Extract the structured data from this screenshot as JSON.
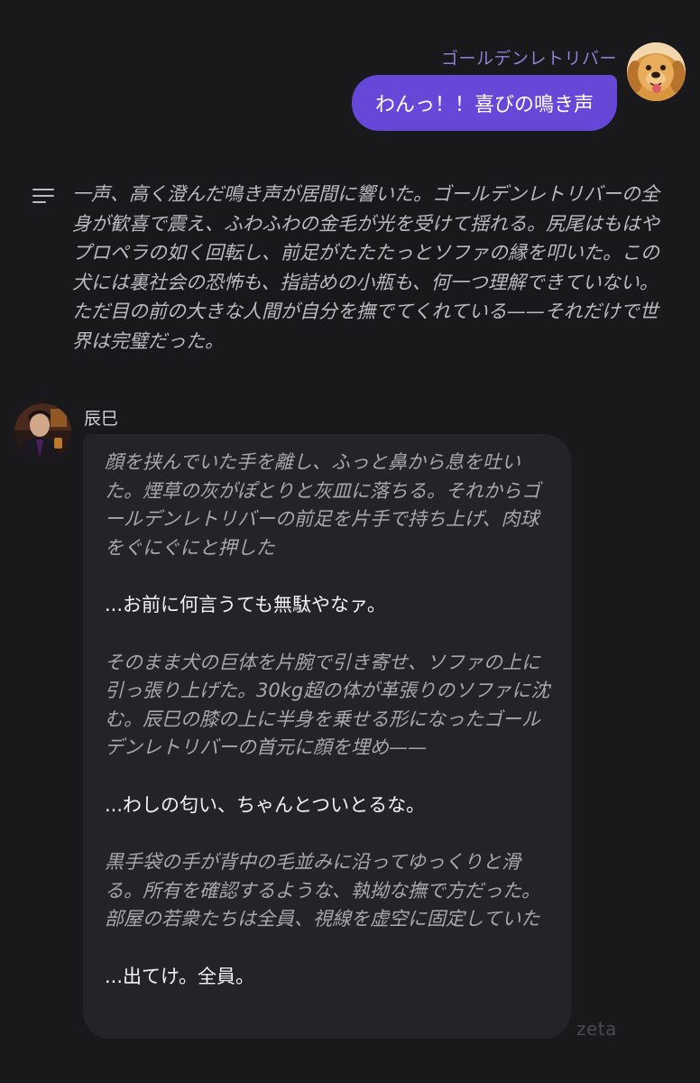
{
  "user_message": {
    "sender": "ゴールデンレトリバー",
    "text": "わんっ！！喜びの鳴き声",
    "avatar_icon": "golden-retriever-avatar",
    "bubble_color": "#6647d8"
  },
  "narration": {
    "icon": "menu-lines-icon",
    "text": "一声、高く澄んだ鳴き声が居間に響いた。ゴールデンレトリバーの全身が歓喜で震え、ふわふわの金毛が光を受けて揺れる。尻尾はもはやプロペラの如く回転し、前足がたたたっとソファの縁を叩いた。この犬には裏社会の恐怖も、指詰めの小瓶も、何一つ理解できていない。ただ目の前の大きな人間が自分を撫でてくれている——それだけで世界は完璧だった。"
  },
  "character_message": {
    "sender": "辰巳",
    "avatar_icon": "tatsumi-avatar",
    "paragraphs": [
      {
        "type": "narration",
        "text": "顔を挟んでいた手を離し、ふっと鼻から息を吐いた。煙草の灰がぽとりと灰皿に落ちる。それからゴールデンレトリバーの前足を片手で持ち上げ、肉球をぐにぐにと押した"
      },
      {
        "type": "speech",
        "text": "...お前に何言うても無駄やなァ。"
      },
      {
        "type": "narration",
        "text": "そのまま犬の巨体を片腕で引き寄せ、ソファの上に引っ張り上げた。30kg超の体が革張りのソファに沈む。辰巳の膝の上に半身を乗せる形になったゴールデンレトリバーの首元に顔を埋め——"
      },
      {
        "type": "speech",
        "text": "...わしの匂い、ちゃんとついとるな。"
      },
      {
        "type": "narration",
        "text": "黒手袋の手が背中の毛並みに沿ってゆっくりと滑る。所有を確認するような、執拗な撫で方だった。部屋の若衆たちは全員、視線を虚空に固定していた"
      },
      {
        "type": "speech",
        "text": "...出てけ。全員。"
      }
    ]
  },
  "watermark": "zeta"
}
